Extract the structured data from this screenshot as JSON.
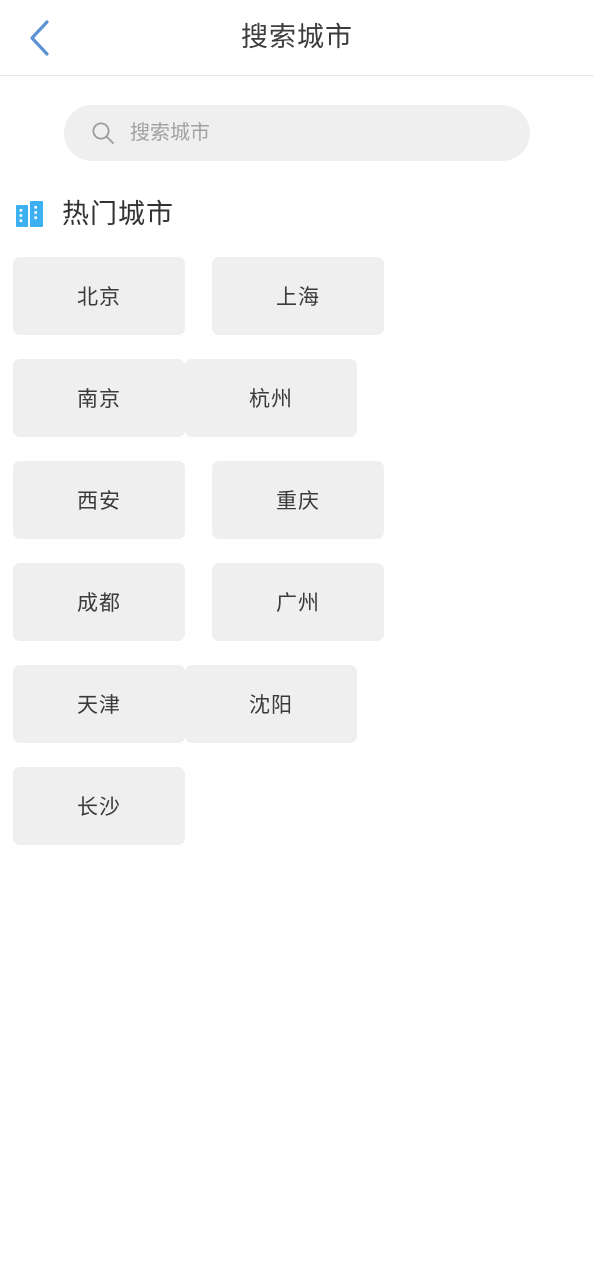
{
  "header": {
    "title": "搜索城市",
    "back_icon": "chevron-left-icon",
    "accent_color": "#5b92d6",
    "divider_color": "#e9e9e9"
  },
  "search": {
    "icon": "search-icon",
    "placeholder": "搜索城市",
    "value": "",
    "background": "#efefef"
  },
  "hot_section": {
    "icon": "city-buildings-icon",
    "icon_color": "#3cb0f0",
    "title": "热门城市",
    "cities": [
      {
        "name": "北京"
      },
      {
        "name": "上海"
      },
      {
        "name": "南京"
      },
      {
        "name": "杭州"
      },
      {
        "name": "西安"
      },
      {
        "name": "重庆"
      },
      {
        "name": "成都"
      },
      {
        "name": "广州"
      },
      {
        "name": "天津"
      },
      {
        "name": "沈阳"
      },
      {
        "name": "长沙"
      }
    ],
    "tile_background": "#efefef",
    "tile_text_color": "#3b3b3b"
  }
}
